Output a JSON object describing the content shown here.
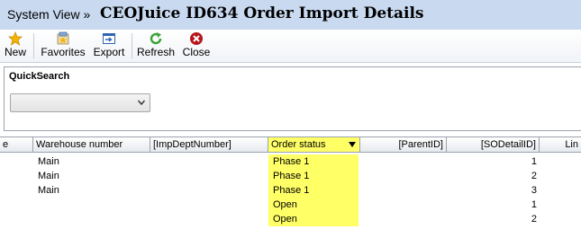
{
  "window": {
    "breadcrumb": "System View »",
    "title": "CEOJuice ID634 Order Import Details"
  },
  "toolbar": {
    "buttons": [
      {
        "label": "New",
        "icon": "star-icon"
      },
      {
        "label": "Favorites",
        "icon": "favorites-icon"
      },
      {
        "label": "Export",
        "icon": "export-icon"
      },
      {
        "label": "Refresh",
        "icon": "refresh-icon"
      },
      {
        "label": "Close",
        "icon": "close-icon"
      }
    ]
  },
  "quicksearch": {
    "label": "QuickSearch",
    "value": ""
  },
  "grid": {
    "columns": [
      {
        "label": "e"
      },
      {
        "label": "Warehouse number"
      },
      {
        "label": "[ImpDeptNumber]"
      },
      {
        "label": "Order status"
      },
      {
        "label": "[ParentID]"
      },
      {
        "label": "[SODetailID]"
      },
      {
        "label": "Lin"
      }
    ],
    "rows": [
      {
        "warehouse": "Main",
        "status": "Phase 1",
        "sodetail": "1"
      },
      {
        "warehouse": "Main",
        "status": "Phase 1",
        "sodetail": "2"
      },
      {
        "warehouse": "Main",
        "status": "Phase 1",
        "sodetail": "3"
      },
      {
        "warehouse": "",
        "status": "Open",
        "sodetail": "1"
      },
      {
        "warehouse": "",
        "status": "Open",
        "sodetail": "2"
      }
    ]
  },
  "colors": {
    "title_bar": "#c8d9f0",
    "highlight": "#ffff66"
  }
}
